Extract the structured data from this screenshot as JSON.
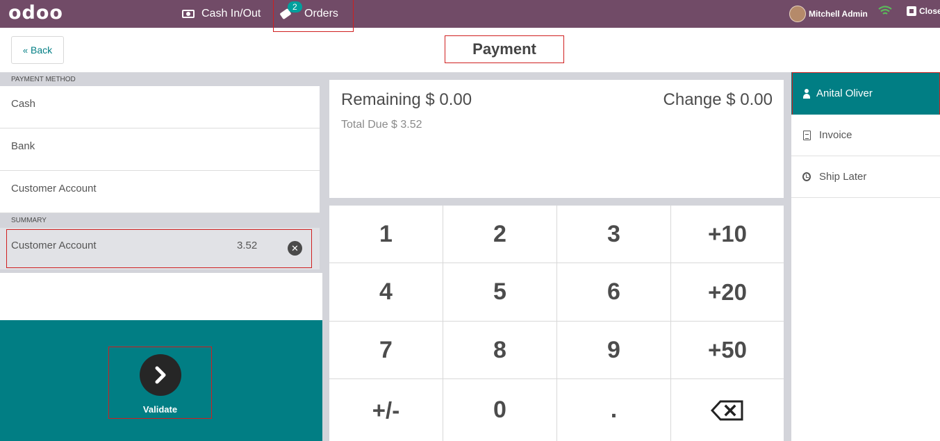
{
  "topbar": {
    "logo": "odoo",
    "cash_label": "Cash In/Out",
    "orders_label": "Orders",
    "orders_count": "2",
    "user_name": "Mitchell Admin",
    "close_label": "Close",
    "bar_color": "#714b67"
  },
  "header": {
    "back_label": "Back",
    "title": "Payment"
  },
  "payment_methods": {
    "header": "PAYMENT METHOD",
    "items": [
      "Cash",
      "Bank",
      "Customer Account"
    ]
  },
  "summary": {
    "header": "SUMMARY",
    "line": {
      "method": "Customer Account",
      "amount": "3.52"
    }
  },
  "status": {
    "remaining": "Remaining $ 0.00",
    "change": "Change $ 0.00",
    "total_due": "Total Due  $ 3.52"
  },
  "numpad": {
    "keys": [
      "1",
      "2",
      "3",
      "+10",
      "4",
      "5",
      "6",
      "+20",
      "7",
      "8",
      "9",
      "+50",
      "+/-",
      "0",
      ".",
      ""
    ]
  },
  "validate": {
    "label": "Validate"
  },
  "right_panel": {
    "customer": "Anital Oliver",
    "invoice_label": "Invoice",
    "ship_later_label": "Ship Later"
  },
  "colors": {
    "accent": "#017e84",
    "brand": "#714b67",
    "highlight": "#d01f1f"
  }
}
